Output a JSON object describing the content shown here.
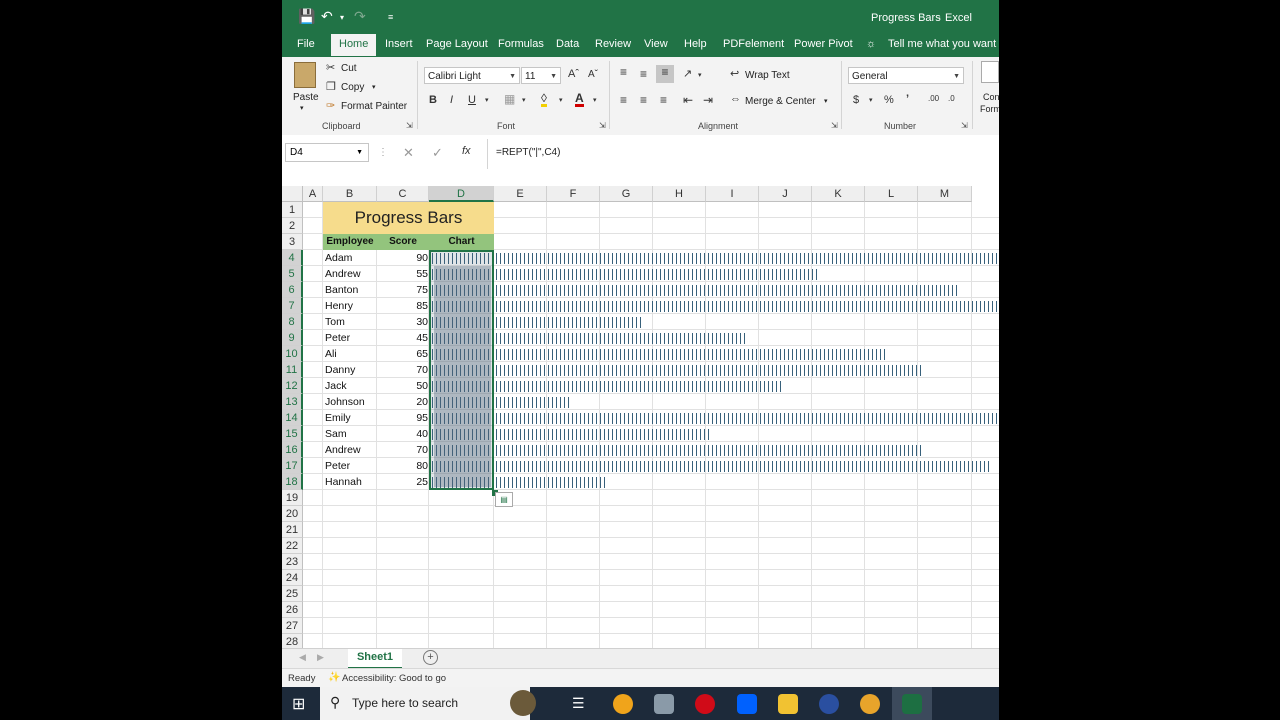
{
  "window": {
    "title": "Progress Bars",
    "app": "Excel",
    "title_sep": "-"
  },
  "ribbon_tabs": [
    "File",
    "Home",
    "Insert",
    "Page Layout",
    "Formulas",
    "Data",
    "Review",
    "View",
    "Help",
    "PDFelement",
    "Power Pivot"
  ],
  "tell_me": "Tell me what you want to",
  "clipboard": {
    "paste": "Paste",
    "cut": "Cut",
    "copy": "Copy",
    "format_painter": "Format Painter",
    "group": "Clipboard"
  },
  "font": {
    "name": "Calibri Light",
    "size": "11",
    "group": "Font"
  },
  "alignment": {
    "wrap": "Wrap Text",
    "merge": "Merge & Center",
    "group": "Alignment"
  },
  "number": {
    "format": "General",
    "group": "Number"
  },
  "styles_partial": {
    "line1": "Con",
    "line2": "Form"
  },
  "formula_bar": {
    "name_box": "D4",
    "formula": "=REPT(\"|\",C4)",
    "fx": "fx"
  },
  "columns": [
    "A",
    "B",
    "C",
    "D",
    "E",
    "F",
    "G",
    "H",
    "I",
    "J",
    "K",
    "L",
    "M"
  ],
  "rows": [
    "1",
    "2",
    "3",
    "4",
    "5",
    "6",
    "7",
    "8",
    "9",
    "10",
    "11",
    "12",
    "13",
    "14",
    "15",
    "16",
    "17",
    "18",
    "19",
    "20",
    "21",
    "22",
    "23",
    "24",
    "25",
    "26",
    "27",
    "28"
  ],
  "sheet": {
    "title": "Progress Bars",
    "headers": {
      "employee": "Employee",
      "score": "Score",
      "chart": "Chart"
    },
    "records": [
      {
        "name": "Adam",
        "score": 90
      },
      {
        "name": "Andrew",
        "score": 55
      },
      {
        "name": "Banton",
        "score": 75
      },
      {
        "name": "Henry",
        "score": 85
      },
      {
        "name": "Tom",
        "score": 30
      },
      {
        "name": "Peter",
        "score": 45
      },
      {
        "name": "Ali",
        "score": 65
      },
      {
        "name": "Danny",
        "score": 70
      },
      {
        "name": "Jack",
        "score": 50
      },
      {
        "name": "Johnson",
        "score": 20
      },
      {
        "name": "Emily",
        "score": 95
      },
      {
        "name": "Sam",
        "score": 40
      },
      {
        "name": "Andrew",
        "score": 70
      },
      {
        "name": "Peter",
        "score": 80
      },
      {
        "name": "Hannah",
        "score": 25
      }
    ]
  },
  "sheet_tab": "Sheet1",
  "status": {
    "ready": "Ready",
    "accessibility": "Accessibility: Good to go"
  },
  "taskbar": {
    "search_placeholder": "Type here to search"
  },
  "colors": {
    "excel_green": "#217346",
    "title_fill": "#f6dc8c",
    "header_fill": "#93c47d",
    "bar": "#37607a"
  }
}
